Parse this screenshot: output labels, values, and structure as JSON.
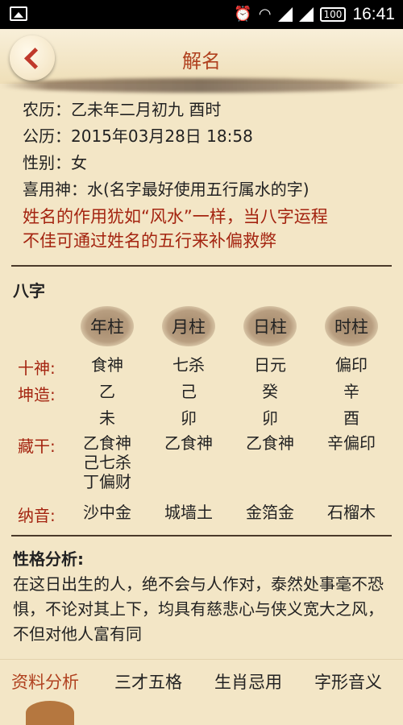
{
  "status_bar": {
    "time": "16:41",
    "battery": "100"
  },
  "header": {
    "title": "解名"
  },
  "info": {
    "lunar_label": "农历：",
    "lunar_value": "乙未年二月初九 酉时",
    "solar_label": "公历：",
    "solar_value": "2015年03月28日 18:58",
    "gender_label": "性别：",
    "gender_value": "女",
    "xiyong_label": "喜用神：",
    "xiyong_value": "水(名字最好使用五行属水的字)",
    "note_line1": "姓名的作用犹如“风水”一样，当八字运程",
    "note_line2": "不佳可通过姓名的五行来补偏救弊"
  },
  "bazi": {
    "title": "八字",
    "pillars": [
      "年柱",
      "月柱",
      "日柱",
      "时柱"
    ],
    "labels": {
      "shishen": "十神:",
      "kunzao": "坤造:",
      "canggan": "藏干:",
      "nayin": "纳音:"
    },
    "shishen": [
      "食神",
      "七杀",
      "日元",
      "偏印"
    ],
    "gan": [
      "乙",
      "己",
      "癸",
      "辛"
    ],
    "zhi": [
      "未",
      "卯",
      "卯",
      "酉"
    ],
    "canggan": [
      [
        "乙食神",
        "己七杀",
        "丁偏财"
      ],
      [
        "乙食神"
      ],
      [
        "乙食神"
      ],
      [
        "辛偏印"
      ]
    ],
    "nayin": [
      "沙中金",
      "城墙土",
      "金箔金",
      "石榴木"
    ]
  },
  "personality": {
    "title": "性格分析:",
    "text": "在这日出生的人，绝不会与人作对，泰然处事毫不恐惧，不论对其上下，均具有慈悲心与侠义宽大之风，不但对他人富有同"
  },
  "tabs": [
    "资料分析",
    "三才五格",
    "生肖忌用",
    "字形音义"
  ]
}
